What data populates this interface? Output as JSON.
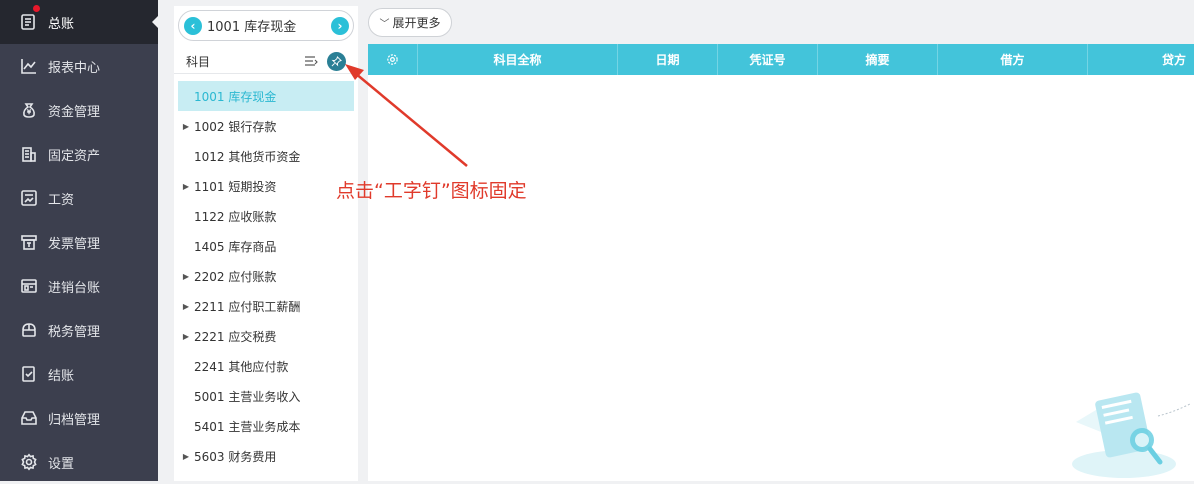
{
  "sidebar": {
    "items": [
      {
        "label": "总账",
        "icon": "ledger-icon",
        "active": true,
        "badge": true
      },
      {
        "label": "报表中心",
        "icon": "chart-icon"
      },
      {
        "label": "资金管理",
        "icon": "money-bag-icon"
      },
      {
        "label": "固定资产",
        "icon": "building-icon"
      },
      {
        "label": "工资",
        "icon": "salary-icon"
      },
      {
        "label": "发票管理",
        "icon": "invoice-icon"
      },
      {
        "label": "进销台账",
        "icon": "inventory-icon"
      },
      {
        "label": "税务管理",
        "icon": "tax-icon"
      },
      {
        "label": "结账",
        "icon": "checkout-icon"
      },
      {
        "label": "归档管理",
        "icon": "archive-icon"
      },
      {
        "label": "设置",
        "icon": "gear-icon"
      }
    ]
  },
  "subject_panel": {
    "selected_account": "1001 库存现金",
    "header_label": "科目",
    "tree": [
      {
        "label": "1001 库存现金",
        "expandable": false,
        "selected": true
      },
      {
        "label": "1002 银行存款",
        "expandable": true
      },
      {
        "label": "1012 其他货币资金",
        "expandable": false
      },
      {
        "label": "1101 短期投资",
        "expandable": true
      },
      {
        "label": "1122 应收账款",
        "expandable": false
      },
      {
        "label": "1405 库存商品",
        "expandable": false
      },
      {
        "label": "2202 应付账款",
        "expandable": true
      },
      {
        "label": "2211 应付职工薪酬",
        "expandable": true
      },
      {
        "label": "2221 应交税费",
        "expandable": true
      },
      {
        "label": "2241 其他应付款",
        "expandable": false
      },
      {
        "label": "5001 主营业务收入",
        "expandable": false
      },
      {
        "label": "5401 主营业务成本",
        "expandable": false
      },
      {
        "label": "5603 财务费用",
        "expandable": true
      }
    ]
  },
  "main": {
    "expand_more_label": "展开更多",
    "table_columns": [
      "",
      "科目全称",
      "日期",
      "凭证号",
      "摘要",
      "借方",
      "贷方"
    ]
  },
  "annotation": {
    "text": "点击“工字钉”图标固定",
    "color": "#e03a2b"
  },
  "colors": {
    "sidebar_bg": "#3c3f4e",
    "accent": "#43c4da",
    "selected_bg": "#c8edf3"
  }
}
